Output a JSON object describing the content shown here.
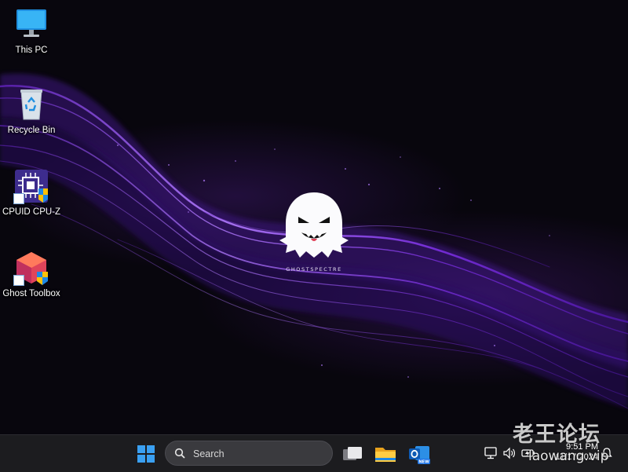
{
  "desktop": {
    "icons": [
      {
        "label": "This PC",
        "icon": "monitor-icon"
      },
      {
        "label": "Recycle Bin",
        "icon": "recycle-bin-icon"
      },
      {
        "label": "CPUID CPU-Z",
        "icon": "cpu-z-icon"
      },
      {
        "label": "Ghost Toolbox",
        "icon": "ghost-toolbox-icon"
      }
    ],
    "wallpaper": {
      "brand_text": "GHOSTSPECTRE",
      "accent_color": "#7b2fd6",
      "logo": "ghost-logo"
    }
  },
  "taskbar": {
    "start_icon": "windows-logo-icon",
    "search": {
      "label": "Search",
      "icon": "search-icon"
    },
    "pinned": [
      {
        "name": "Task View",
        "icon": "task-view-icon"
      },
      {
        "name": "File Explorer",
        "icon": "folder-icon"
      },
      {
        "name": "Outlook (new)",
        "icon": "outlook-icon",
        "badge": "NEW"
      }
    ],
    "tray": {
      "icons": [
        "network-icon",
        "volume-icon",
        "battery-icon"
      ],
      "time": "9:51 PM",
      "date": "11/17/2024",
      "notification_icon": "notification-bell-icon"
    },
    "accent_color": "#1e88e5"
  },
  "watermark": {
    "chinese": "老王论坛",
    "url": "laowang.vip"
  }
}
